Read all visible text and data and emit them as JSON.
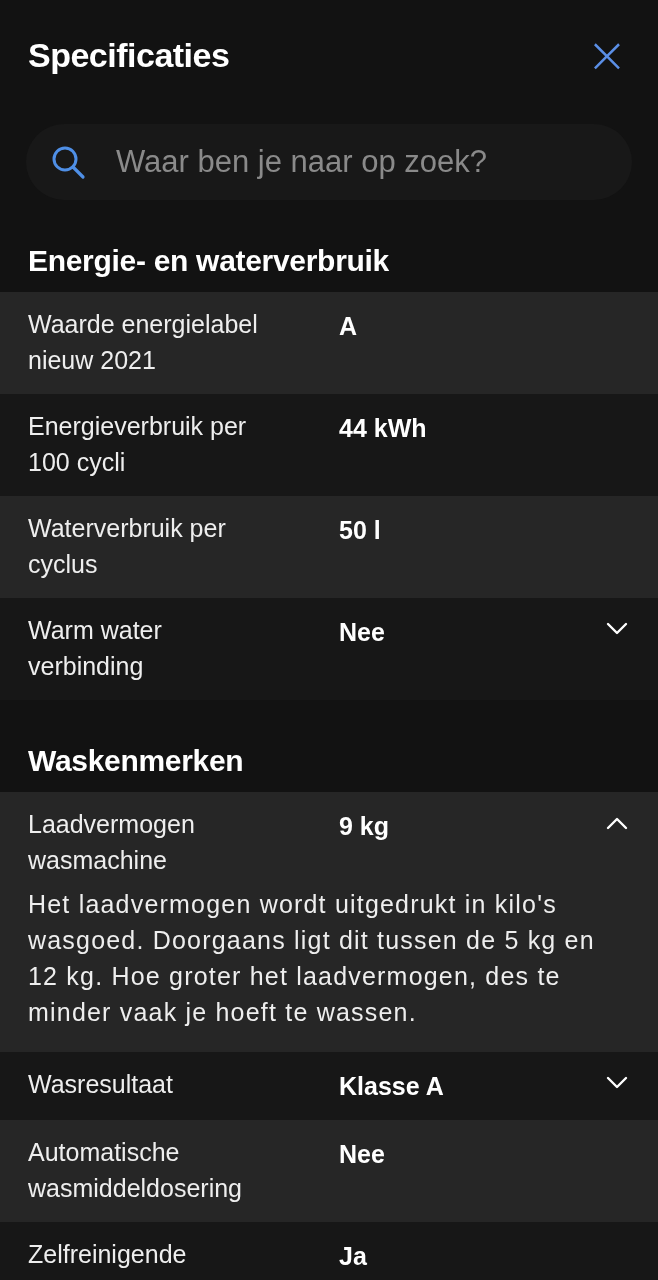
{
  "header": {
    "title": "Specificaties",
    "close": "×"
  },
  "search": {
    "placeholder": "Waar ben je naar op zoek?"
  },
  "sections": [
    {
      "title": "Energie- en waterverbruik",
      "rows": [
        {
          "label": "Waarde energielabel nieuw 2021",
          "value": "A"
        },
        {
          "label": "Energieverbruik per 100 cycli",
          "value": "44 kWh"
        },
        {
          "label": "Waterverbruik per cyclus",
          "value": "50 l"
        },
        {
          "label": "Warm water verbinding",
          "value": "Nee",
          "expanded": false
        }
      ]
    },
    {
      "title": "Waskenmerken",
      "rows": [
        {
          "label": "Laadvermogen wasmachine",
          "value": "9 kg",
          "expanded": true,
          "description": "Het laadvermogen wordt uitgedrukt in kilo's wasgoed. Doorgaans ligt dit tussen de 5 kg en 12 kg. Hoe groter het laadvermogen, des te minder vaak je hoeft te wassen."
        },
        {
          "label": "Wasresultaat",
          "value": "Klasse A",
          "expanded": false
        },
        {
          "label": "Automatische wasmiddeldosering",
          "value": "Nee"
        },
        {
          "label": "Zelfreinigende",
          "value": "Ja"
        }
      ]
    }
  ]
}
